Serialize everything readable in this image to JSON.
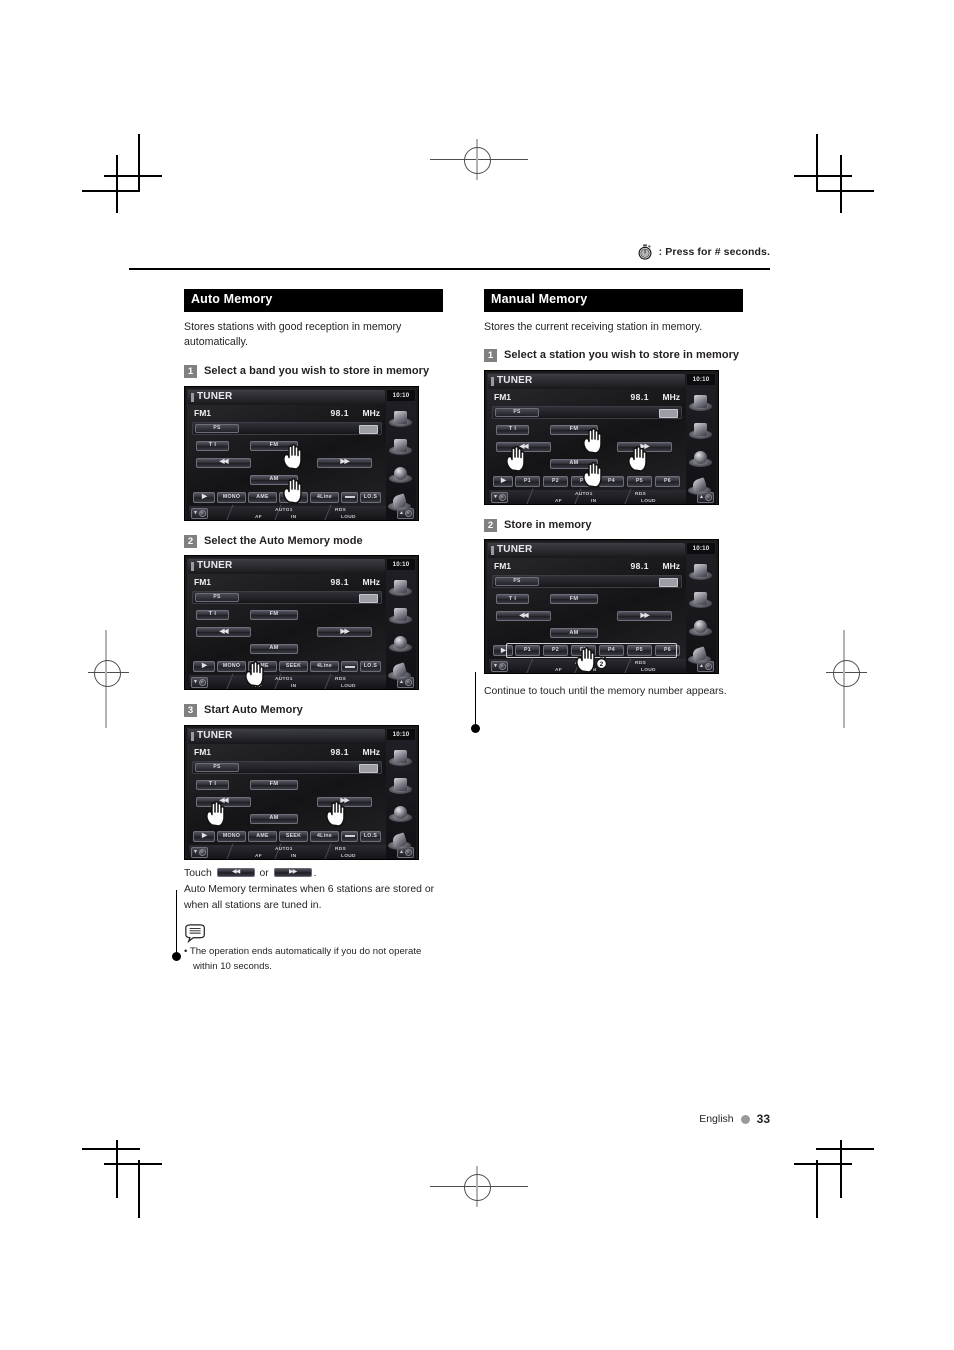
{
  "header": {
    "note_text": ": Press for # seconds.",
    "stopwatch_icon": "stopwatch-icon"
  },
  "footer": {
    "language": "English",
    "page_number": "33"
  },
  "left_column": {
    "section_title": "Auto Memory",
    "lead": "Stores stations with good reception in memory automatically.",
    "steps": [
      {
        "num": "1",
        "title": "Select a band you wish to store in memory"
      },
      {
        "num": "2",
        "title": "Select the Auto Memory mode"
      },
      {
        "num": "3",
        "title": "Start Auto Memory"
      }
    ],
    "caption_touch_prefix": "Touch",
    "caption_touch_or": "or",
    "caption_touch_suffix": ".",
    "caption_terminate": "Auto Memory terminates when 6 stations are stored or when all stations are tuned in.",
    "note_icon": "note-book-icon",
    "note_bullet": "• The operation ends automatically if you do not operate within 10 seconds."
  },
  "right_column": {
    "section_title": "Manual Memory",
    "lead": "Stores the current receiving station in memory.",
    "steps": [
      {
        "num": "1",
        "title": "Select a station you wish to store in memory"
      },
      {
        "num": "2",
        "title": "Store in memory"
      }
    ],
    "caption_continue": "Continue to touch until the memory number appears."
  },
  "device_screen": {
    "source_label": "TUNER",
    "clock": "10:10",
    "band": "FM1",
    "frequency": "98.1",
    "unit": "MHz",
    "ps_button": "PS",
    "ti_button": "T I",
    "fm_button": "FM",
    "am_button": "AM",
    "prev_button": "◀◀",
    "next_button": "▶▶",
    "function_buttons": [
      "MONO",
      "AME",
      "SEEK",
      "4Line",
      "",
      "LO.S"
    ],
    "preset_buttons": [
      "P1",
      "P2",
      "P3",
      "P4",
      "P5",
      "P6"
    ],
    "status_labels": [
      "AUTO1",
      "AF",
      "IN",
      "RDS",
      "LOUD"
    ],
    "seconds_badge": "2"
  }
}
